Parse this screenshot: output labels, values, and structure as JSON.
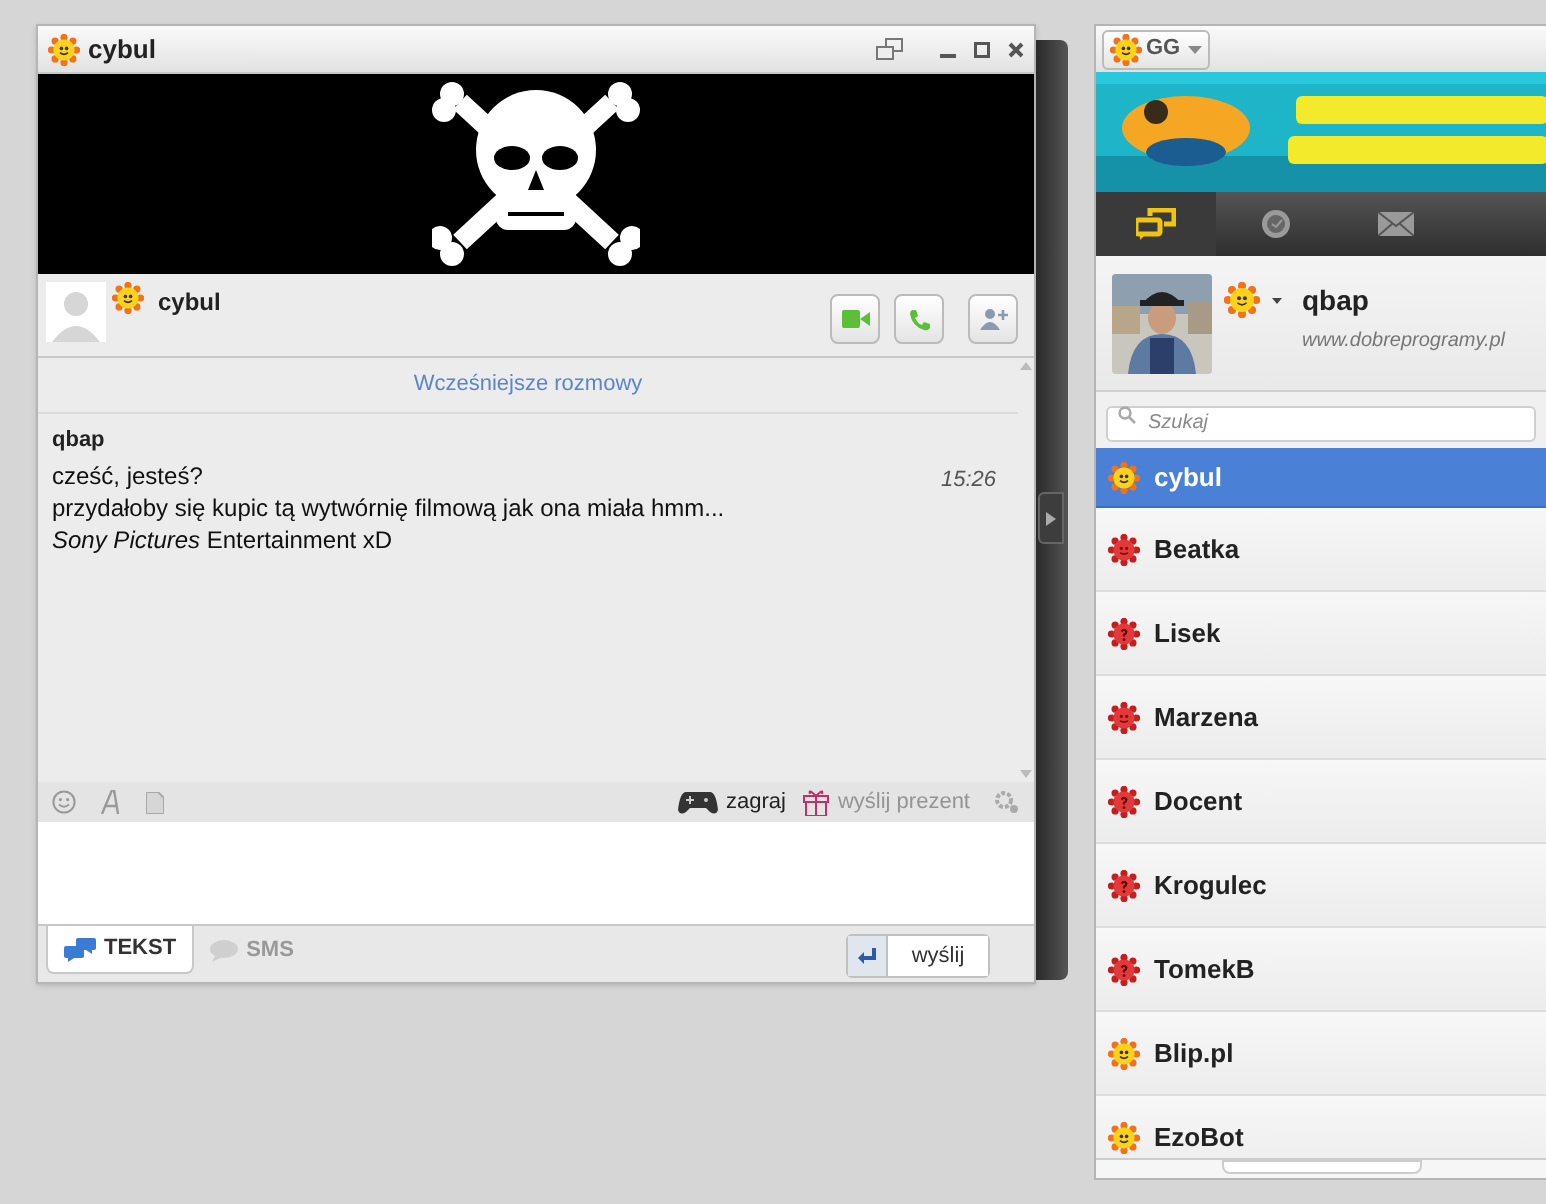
{
  "chat_window": {
    "title": "cybul",
    "contact": {
      "name": "cybul"
    },
    "history_link": "Wcześniejsze rozmowy",
    "messages": [
      {
        "sender": "qbap",
        "time": "15:26",
        "lines": [
          "cześć, jesteś?",
          "przydałoby się kupic tą wytwórnię filmową jak ona miała hmm...",
          "*Sony Pictures* Entertainment xD"
        ]
      }
    ],
    "toolbar": {
      "game_label": "zagraj",
      "gift_label": "wyślij prezent",
      "gift_disabled": true
    },
    "mode_tabs": [
      {
        "label": "TEKST",
        "selected": true
      },
      {
        "label": "SMS",
        "selected": false
      }
    ],
    "send_button": "wyślij"
  },
  "contacts_window": {
    "menu_button": "GG",
    "nav_tabs": [
      {
        "kind": "chats",
        "selected": true
      },
      {
        "kind": "history",
        "selected": false
      },
      {
        "kind": "mail",
        "selected": false
      }
    ],
    "profile": {
      "name": "qbap",
      "description": "www.dobreprogramy.pl"
    },
    "search": {
      "placeholder": "Szukaj"
    },
    "contacts": [
      {
        "name": "cybul",
        "kind": "online",
        "selected": true
      },
      {
        "name": "Beatka",
        "kind": "offline",
        "selected": false
      },
      {
        "name": "Lisek",
        "kind": "unknown",
        "selected": false
      },
      {
        "name": "Marzena",
        "kind": "offline",
        "selected": false
      },
      {
        "name": "Docent",
        "kind": "unknown",
        "selected": false
      },
      {
        "name": "Krogulec",
        "kind": "unknown",
        "selected": false
      },
      {
        "name": "TomekB",
        "kind": "unknown",
        "selected": false
      },
      {
        "name": "Blip.pl",
        "kind": "online",
        "selected": false
      },
      {
        "name": "EzoBot",
        "kind": "online",
        "selected": false
      }
    ]
  }
}
